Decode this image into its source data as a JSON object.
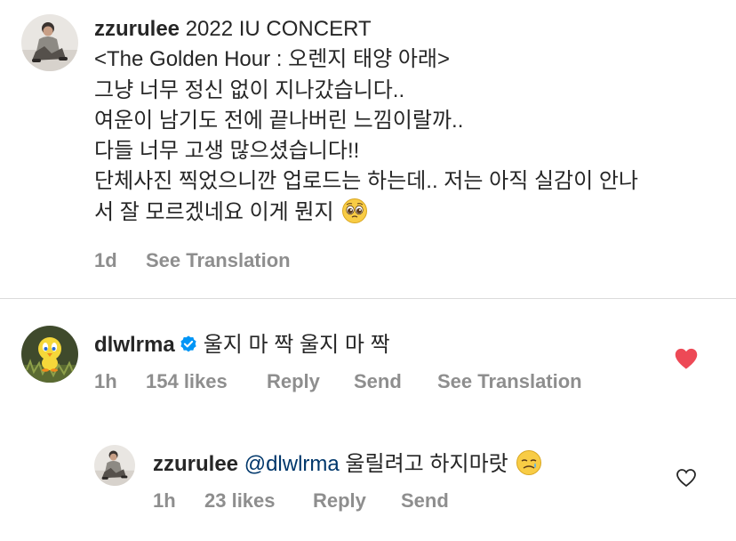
{
  "post": {
    "username": "zzurulee",
    "caption_lines": [
      "2022 IU CONCERT",
      "<The Golden Hour : 오렌지 태양 아래>",
      "그냥 너무 정신 없이 지나갔습니다..",
      "여운이 남기도 전에 끝나버린 느낌이랄까..",
      "다들 너무 고생 많으셨습니다!!",
      "단체사진 찍었으니깐 업로드는 하는데.. 저는 아직 실감이 안나",
      "서 잘 모르겠네요 이게 뭔지"
    ],
    "emoji": "pleading-face-emoji",
    "time": "1d",
    "see_translation": "See Translation"
  },
  "comment": {
    "username": "dlwlrma",
    "verified_icon": "verified-badge-icon",
    "text": "울지 마 짝 울지 마 짝",
    "time": "1h",
    "likes": "154 likes",
    "reply": "Reply",
    "send": "Send",
    "see_translation": "See Translation",
    "liked": true,
    "heart_color": "#ed4956"
  },
  "reply": {
    "username": "zzurulee",
    "mention": "@dlwlrma",
    "text": "울릴려고 하지마랏",
    "emoji": "face-holding-back-tears-emoji",
    "time": "1h",
    "likes": "23 likes",
    "reply": "Reply",
    "send": "Send",
    "liked": false
  },
  "colors": {
    "text": "#262626",
    "secondary": "#8e8e8e",
    "link": "#00376b",
    "verified": "#0095f6",
    "like": "#ed4956"
  }
}
